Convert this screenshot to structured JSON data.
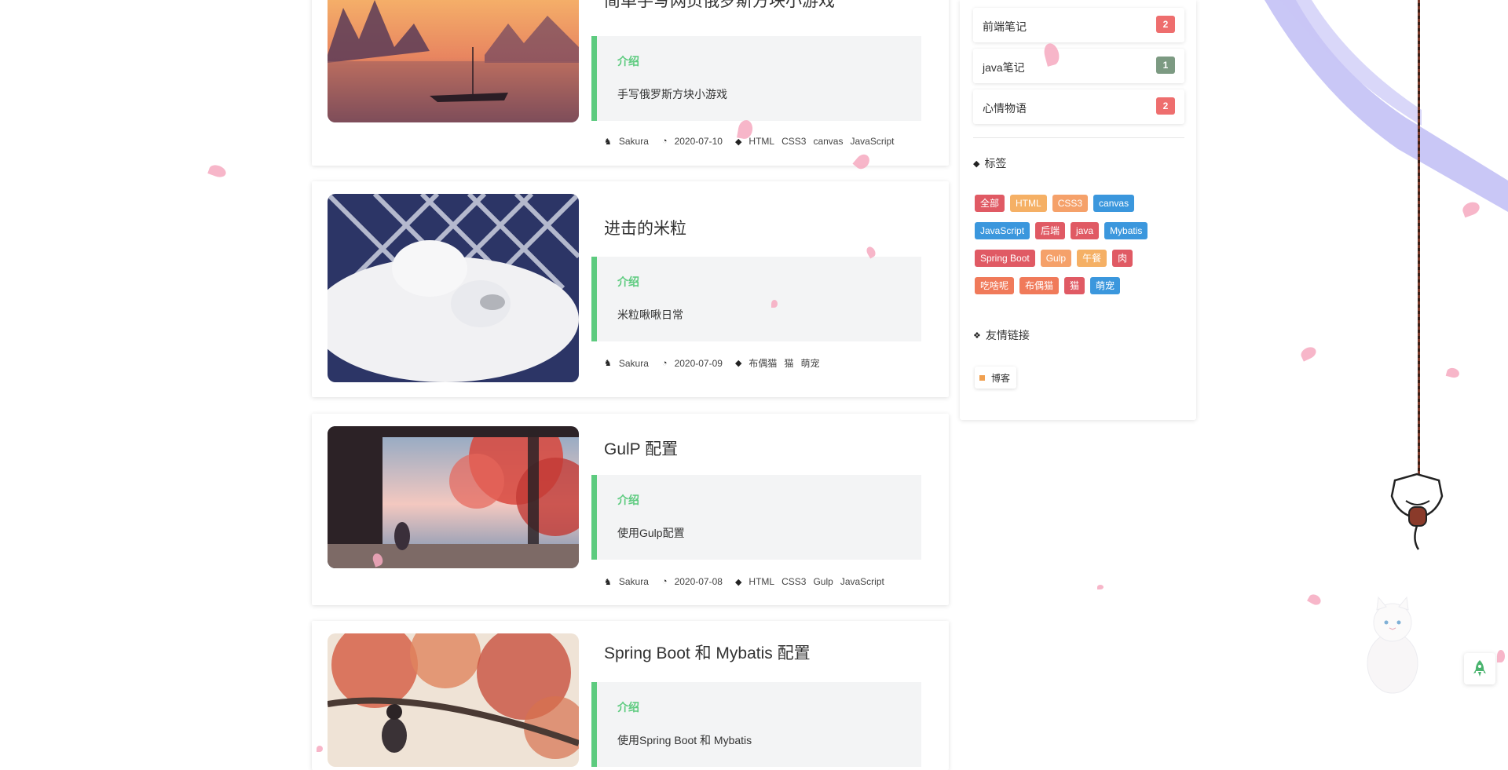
{
  "posts": [
    {
      "title": "简单手写网页俄罗斯方块小游戏",
      "intro_label": "介绍",
      "intro_text": "手写俄罗斯方块小游戏",
      "author": "Sakura",
      "date": "2020-07-10",
      "tags": [
        "HTML",
        "CSS3",
        "canvas",
        "JavaScript"
      ]
    },
    {
      "title": "进击的米粒",
      "intro_label": "介绍",
      "intro_text": "米粒啾啾日常",
      "author": "Sakura",
      "date": "2020-07-09",
      "tags": [
        "布偶猫",
        "猫",
        "萌宠"
      ]
    },
    {
      "title": "GulP 配置",
      "intro_label": "介绍",
      "intro_text": "使用Gulp配置",
      "author": "Sakura",
      "date": "2020-07-08",
      "tags": [
        "HTML",
        "CSS3",
        "Gulp",
        "JavaScript"
      ]
    },
    {
      "title": "Spring Boot 和 Mybatis 配置",
      "intro_label": "介绍",
      "intro_text": "使用Spring Boot 和 Mybatis"
    }
  ],
  "sidebar": {
    "categories": [
      {
        "name": "前端笔记",
        "count": "2",
        "color": "#ee6e6e"
      },
      {
        "name": "java笔记",
        "count": "1",
        "color": "#7c9a82"
      },
      {
        "name": "心情物语",
        "count": "2",
        "color": "#ee6e6e"
      }
    ],
    "tags_title": "标签",
    "tags": [
      [
        {
          "label": "全部",
          "color": "#e05a64"
        },
        {
          "label": "HTML",
          "color": "#f5b065"
        },
        {
          "label": "CSS3",
          "color": "#f5a16a"
        },
        {
          "label": "canvas",
          "color": "#3b97dd"
        }
      ],
      [
        {
          "label": "JavaScript",
          "color": "#3b97dd"
        },
        {
          "label": "后端",
          "color": "#e05a64"
        },
        {
          "label": "java",
          "color": "#e05a64"
        },
        {
          "label": "Mybatis",
          "color": "#3b97dd"
        }
      ],
      [
        {
          "label": "Spring Boot",
          "color": "#e05a64"
        },
        {
          "label": "Gulp",
          "color": "#f5a16a"
        },
        {
          "label": "午餐",
          "color": "#f5b065"
        },
        {
          "label": "肉",
          "color": "#e05a64"
        }
      ],
      [
        {
          "label": "吃啥呢",
          "color": "#f07a5a"
        },
        {
          "label": "布偶猫",
          "color": "#f07a5a"
        },
        {
          "label": "猫",
          "color": "#e05a64"
        },
        {
          "label": "萌宠",
          "color": "#3b97dd"
        }
      ]
    ],
    "links_title": "友情链接",
    "links": [
      {
        "label": "博客"
      }
    ]
  },
  "icons": {
    "author": "user-icon",
    "date": "clock-icon",
    "tags": "tag-icon",
    "back_to_top": "rocket-icon"
  },
  "colors": {
    "accent_green": "#5dcb7f"
  }
}
